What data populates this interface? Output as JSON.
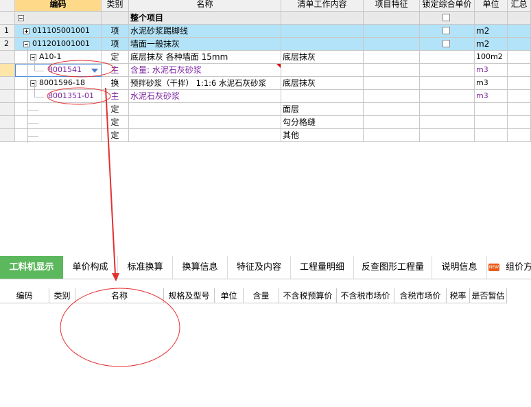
{
  "top_grid": {
    "headers": [
      "编码",
      "类别",
      "名称",
      "清单工作内容",
      "项目特征",
      "锁定综合单价",
      "单位",
      "汇总"
    ],
    "rows": [
      {
        "num": "",
        "code": "",
        "type": "",
        "name": "整个项目",
        "work": "",
        "unit": ""
      },
      {
        "num": "1",
        "code": "011105001001",
        "type": "项",
        "name": "水泥砂浆踢脚线",
        "work": "",
        "unit": "m2"
      },
      {
        "num": "2",
        "code": "011201001001",
        "type": "项",
        "name": "墙面一般抹灰",
        "work": "",
        "unit": "m2"
      },
      {
        "num": "",
        "code": "A10-1",
        "type": "定",
        "name": "底层抹灰 各种墙面 15mm",
        "work": "底层抹灰",
        "unit": "100m2"
      },
      {
        "num": "",
        "code": "8001541",
        "type": "主",
        "name": "含量: 水泥石灰砂浆",
        "work": "",
        "unit": "m3"
      },
      {
        "num": "",
        "code": "8001596-18",
        "type": "换",
        "name": "预拌砂浆（干拌） 1:1:6 水泥石灰砂浆",
        "work": "底层抹灰",
        "unit": "m3"
      },
      {
        "num": "",
        "code": "8001351-01",
        "type": "主",
        "name": "水泥石灰砂浆",
        "work": "",
        "unit": "m3"
      },
      {
        "num": "",
        "code": "",
        "type": "定",
        "name": "",
        "work": "面层",
        "unit": ""
      },
      {
        "num": "",
        "code": "",
        "type": "定",
        "name": "",
        "work": "勾分格缝",
        "unit": ""
      },
      {
        "num": "",
        "code": "",
        "type": "定",
        "name": "",
        "work": "其他",
        "unit": ""
      }
    ]
  },
  "tabs": [
    "工料机显示",
    "单价构成",
    "标准换算",
    "换算信息",
    "特征及内容",
    "工程量明细",
    "反查图形工程量",
    "说明信息",
    "组价方"
  ],
  "new_badge": "NEW",
  "bottom_headers": [
    "编码",
    "类别",
    "名称",
    "规格及型号",
    "单位",
    "含量",
    "不含税预算价",
    "不含税市场价",
    "含税市场价",
    "税率",
    "是否暂估"
  ],
  "colors": {
    "highlight_row": "#b3e3f8",
    "active_tab": "#5cb85c",
    "selected_header": "#ffd98a",
    "purple_text": "#7a1fa0",
    "annotation_red": "#e53030"
  }
}
